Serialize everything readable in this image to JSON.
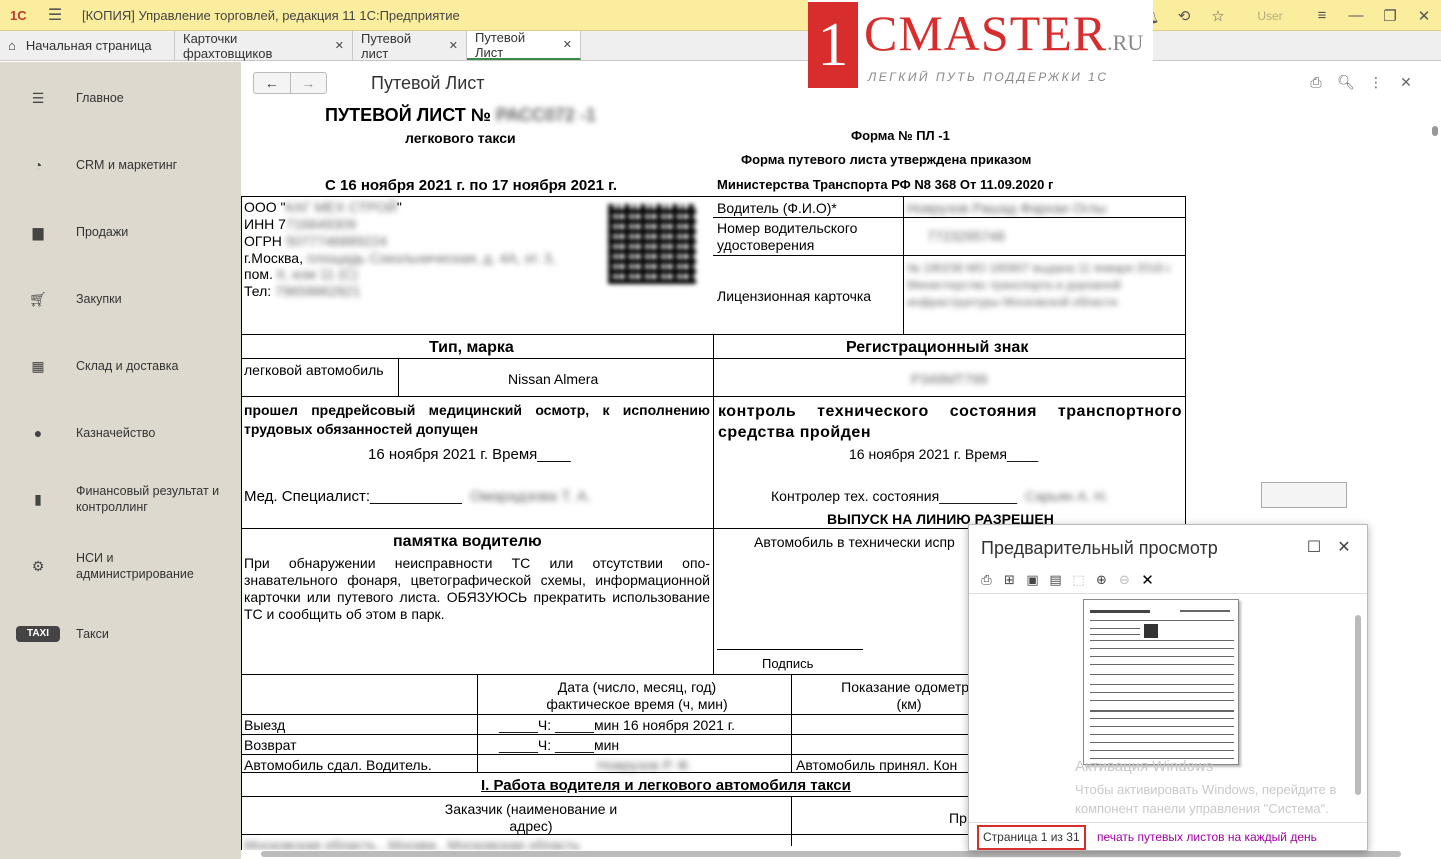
{
  "titlebar": {
    "logo": "1С",
    "title": "[КОПИЯ] Управление торговлей, редакция 11 1С:Предприятие",
    "user": "User"
  },
  "tabs": [
    {
      "label": "Начальная страница",
      "icon": "home-icon"
    },
    {
      "label": "Карточки фрахтовщиков",
      "closable": true
    },
    {
      "label": "Путевой лист",
      "closable": true
    },
    {
      "label": "Путевой Лист",
      "closable": true,
      "active": true
    }
  ],
  "sidebar": {
    "items": [
      {
        "label": "Главное",
        "icon": "menu-icon"
      },
      {
        "label": "CRM и маркетинг",
        "icon": "pie-chart-icon"
      },
      {
        "label": "Продажи",
        "icon": "shopping-bag-icon"
      },
      {
        "label": "Закупки",
        "icon": "cart-icon"
      },
      {
        "label": "Склад и доставка",
        "icon": "warehouse-icon"
      },
      {
        "label": "Казначейство",
        "icon": "coin-icon"
      },
      {
        "label": "Финансовый результат и контроллинг",
        "icon": "bar-chart-icon"
      },
      {
        "label": "НСИ и администрирование",
        "icon": "gear-icon"
      },
      {
        "label": "Такси",
        "icon": "taxi-icon",
        "icon_text": "TAXI"
      }
    ]
  },
  "brand": {
    "one": "1",
    "main": "CMASTER",
    "ru": ".RU",
    "tagline": "ЛЕГКИЙ ПУТЬ ПОДДЕРЖКИ 1С"
  },
  "header": {
    "title": "Путевой Лист"
  },
  "doc": {
    "heading": "ПУТЕВОЙ ЛИСТ №",
    "heading_number": "РАСС072 -1",
    "subheading": "легкового такси",
    "form_no": "Форма № ПЛ -1",
    "form_approved": "Форма путевого листа утверждена приказом",
    "form_ministry": "Министерства Транспорта РФ N8 368 От 11.09.2020 г",
    "period": "С 16 ноября 2021 г. по 17 ноября 2021 г.",
    "org": {
      "name_prefix": "ООО \"",
      "name": "КАГ МЕХ СТРОЙ",
      "name_suffix": "\"",
      "inn_label": "ИНН 7",
      "inn": "716649309",
      "ogrn_label": "ОГРН",
      "ogrn": "5077746889224",
      "city": "г.Москва,",
      "address": "площадь Сокольническая, д. 4А, эт. 3,",
      "room_label": "пом.",
      "room": "II, ком 11 (С)",
      "phone_label": "Тел:",
      "phone": "79658862821"
    },
    "driver_label": "Водитель (Ф.И.О)*",
    "driver_value": "Новрузов Рашад Фархаи Оглы",
    "license_label": "Номер водительского удостоверения",
    "license_value": "7723295748",
    "card_label": "Лицензионная карточка",
    "card_value": "№ 190236 МО 185907 выдана 11 января 2018 г. Министерство транспорта и дорожной инфраструктуры Московской области",
    "type_header": "Тип, марка",
    "reg_header": "Регистрационный знак",
    "vehicle_type": "легковой автомобиль",
    "vehicle_model": "Nissan Almera",
    "reg_value": "Р349МТ799",
    "med_text": "прошел предрейсовый медицинский осмотр, к исполнению трудовых обязанностей допущен",
    "med_date": "16 ноября 2021 г. Время____",
    "med_spec_label": "Мед. Специалист:___________",
    "med_spec_value": "Омарадзова Т. А.",
    "tech_text": "контроль технического состояния транспортного средства пройден",
    "tech_date": "16 ноября 2021 г. Время____",
    "tech_ctrl_label": "Контролер тех. состояния__________",
    "tech_ctrl_value": "Сарьян А. Н.",
    "release": "ВЫПУСК НА ЛИНИЮ РАЗРЕШЕН",
    "memo_header": "памятка водителю",
    "memo_text": "При обнаружении неисправности ТС или отсутствии опо- знавательного фонаря, цветографической схемы, информационной карточки или путевого листа. ОБЯЗУЮСЬ прекратить использование ТС и сообщить об этом в парк.",
    "car_condition": "Автомобиль в технически испр",
    "signature": "Подпись",
    "date_header": "Дата (число, месяц, год) фактическое время (ч, мин)",
    "odometer_header": "Показание одометра (км)",
    "exit_label": "Выезд",
    "return_label": "Возврат",
    "time_row_exit": "_____Ч: _____мин  16 ноября 2021 г.",
    "time_row_return": "_____Ч: _____мин",
    "handover_label": "Автомобиль сдал. Водитель.____________________",
    "handover_value": "Новрузов Р. Ф.",
    "accepted_label": "Автомобиль принял. Кон",
    "work_header": "I.  Работа водителя и легкового автомобиля такси",
    "customer_header": "Заказчик (наименование и адрес)",
    "pr_label": "Пр",
    "bottom_row": "Московская область , Москва , Московская область"
  },
  "preview": {
    "title": "Предварительный просмотр",
    "page_info": "Страница 1 из 31",
    "link": "печать путевых листов на каждый день",
    "activate_title": "Активация Windows",
    "activate_line1": "Чтобы активировать Windows, перейдите в",
    "activate_line2": "компонент панели управления \"Система\"."
  }
}
